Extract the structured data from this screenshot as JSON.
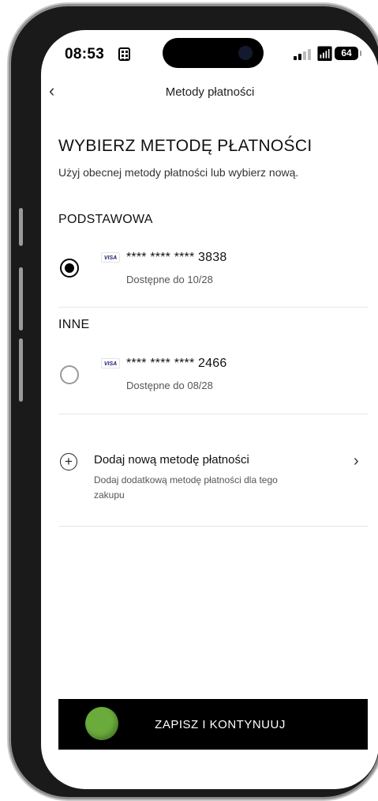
{
  "status_bar": {
    "time": "08:53",
    "battery": "64"
  },
  "nav": {
    "back_icon": "chevron-left-icon",
    "back_glyph": "‹",
    "title": "Metody płatności"
  },
  "header": {
    "title": "WYBIERZ METODĘ PŁATNOŚCI",
    "subtitle": "Użyj obecnej metody płatności lub wybierz nową."
  },
  "primary": {
    "section_title": "PODSTAWOWA",
    "card": {
      "brand": "VISA",
      "number": "**** **** **** 3838",
      "expiry": "Dostępne do 10/28",
      "selected": true
    }
  },
  "other": {
    "section_title": "INNE",
    "card": {
      "brand": "VISA",
      "number": "**** **** **** 2466",
      "expiry": "Dostępne do 08/28",
      "selected": false
    }
  },
  "add_method": {
    "icon": "plus-circle-icon",
    "plus_glyph": "+",
    "title": "Dodaj nową metodę płatności",
    "description": "Dodaj dodatkową metodę płatności dla tego zakupu",
    "chevron_glyph": "›"
  },
  "cta": {
    "label": "ZAPISZ I KONTYNUUJ",
    "dot_color": "#6aab3c"
  },
  "colors": {
    "background": "#ffffff",
    "text": "#111111",
    "button": "#000000"
  }
}
